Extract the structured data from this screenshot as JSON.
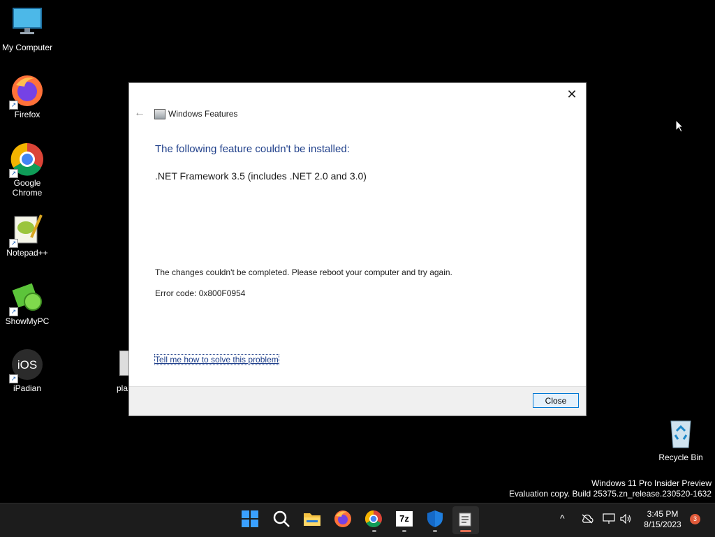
{
  "desktop": {
    "icons": [
      {
        "label": "My Computer",
        "icon": "monitor-icon"
      },
      {
        "label": "Firefox",
        "icon": "firefox-icon"
      },
      {
        "label": "Google Chrome",
        "icon": "chrome-icon"
      },
      {
        "label": "Notepad++",
        "icon": "notepadpp-icon"
      },
      {
        "label": "ShowMyPC",
        "icon": "showmypc-icon"
      },
      {
        "label": "iPadian",
        "icon": "ipadian-icon"
      },
      {
        "label": "pla",
        "icon": "file-icon"
      },
      {
        "label": "Recycle Bin",
        "icon": "recycle-bin-icon"
      }
    ]
  },
  "dialog": {
    "app_title": "Windows Features",
    "heading": "The following feature couldn't be installed:",
    "feature": ".NET Framework 3.5 (includes .NET 2.0 and 3.0)",
    "message": "The changes couldn't be completed. Please reboot your computer and try again.",
    "error_code": "Error code: 0x800F0954",
    "help_link": "Tell me how to solve this problem",
    "close_button": "Close",
    "close_glyph": "✕",
    "back_glyph": "←"
  },
  "watermark": {
    "line1": "Windows 11 Pro Insider Preview",
    "line2": "Evaluation copy. Build 25375.zn_release.230520-1632"
  },
  "taskbar": {
    "apps": [
      "start-icon",
      "search-icon",
      "file-explorer-icon",
      "firefox-icon",
      "chrome-icon",
      "7zip-icon",
      "defender-icon",
      "windows-features-icon"
    ],
    "sevenzip_label": "7z",
    "tray": {
      "chevron": "^",
      "time": "3:45 PM",
      "date": "8/15/2023",
      "notification_count": "3"
    }
  }
}
